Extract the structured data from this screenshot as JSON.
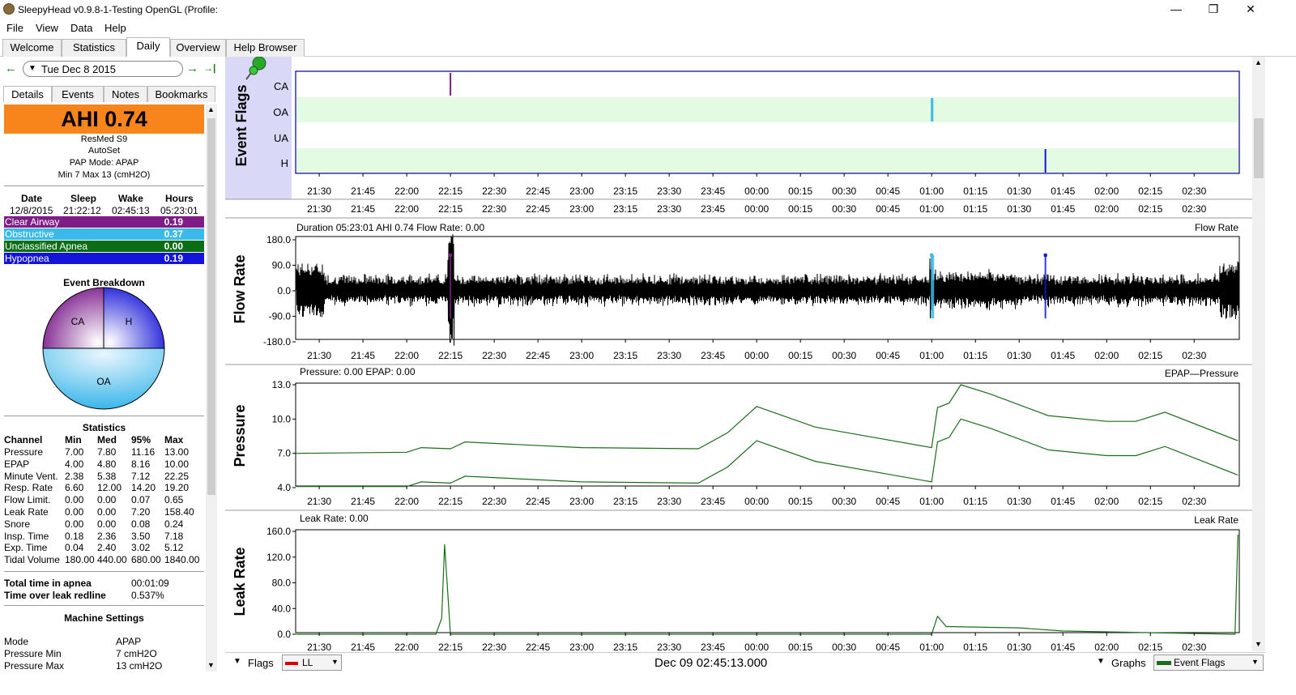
{
  "window": {
    "title": "SleepyHead v0.9.8-1-Testing OpenGL (Profile:",
    "minimize": "—",
    "maximize": "❐",
    "close": "✕"
  },
  "menu": [
    "File",
    "View",
    "Data",
    "Help"
  ],
  "tabs": [
    "Welcome",
    "Statistics",
    "Daily",
    "Overview",
    "Help Browser"
  ],
  "nav": {
    "prev": "←",
    "date": "Tue Dec 8 2015",
    "next": "→",
    "last": "→|"
  },
  "subtabs": [
    "Details",
    "Events",
    "Notes",
    "Bookmarks"
  ],
  "ahi": "AHI 0.74",
  "machine": {
    "model": "ResMed S9",
    "type": "AutoSet",
    "mode": "PAP Mode: APAP",
    "range": "Min 7 Max 13 (cmH2O)"
  },
  "session": {
    "headers": [
      "Date",
      "Sleep",
      "Wake",
      "Hours"
    ],
    "values": [
      "12/8/2015",
      "21:22:12",
      "02:45:13",
      "05:23:01"
    ]
  },
  "events": [
    {
      "name": "Clear Airway",
      "value": "0.19",
      "color": "#7f1d86"
    },
    {
      "name": "Obstructive",
      "value": "0.37",
      "color": "#3bb9e8"
    },
    {
      "name": "Unclassified Apnea",
      "value": "0.00",
      "color": "#0b6e16"
    },
    {
      "name": "Hypopnea",
      "value": "0.19",
      "color": "#1414d9"
    }
  ],
  "breakdown": {
    "title": "Event Breakdown",
    "ca": "CA",
    "h": "H",
    "oa": "OA"
  },
  "statistics": {
    "title": "Statistics",
    "headers": [
      "Channel",
      "Min",
      "Med",
      "95%",
      "Max"
    ],
    "rows": [
      [
        "Pressure",
        "7.00",
        "7.80",
        "11.16",
        "13.00"
      ],
      [
        "EPAP",
        "4.00",
        "4.80",
        "8.16",
        "10.00"
      ],
      [
        "Minute Vent.",
        "2.38",
        "5.38",
        "7.12",
        "22.25"
      ],
      [
        "Resp. Rate",
        "6.60",
        "12.00",
        "14.20",
        "19.20"
      ],
      [
        "Flow Limit.",
        "0.00",
        "0.00",
        "0.07",
        "0.65"
      ],
      [
        "Leak Rate",
        "0.00",
        "0.00",
        "7.20",
        "158.40"
      ],
      [
        "Snore",
        "0.00",
        "0.00",
        "0.08",
        "0.24"
      ],
      [
        "Insp. Time",
        "0.18",
        "2.36",
        "3.50",
        "7.18"
      ],
      [
        "Exp. Time",
        "0.04",
        "2.40",
        "3.02",
        "5.12"
      ],
      [
        "Tidal Volume",
        "180.00",
        "440.00",
        "680.00",
        "1840.00"
      ]
    ]
  },
  "totals": [
    {
      "label": "Total time in apnea",
      "value": "00:01:09"
    },
    {
      "label": "Time over leak redline",
      "value": "0.537%"
    }
  ],
  "machine_settings": {
    "title": "Machine Settings",
    "rows": [
      {
        "label": "Mode",
        "value": "APAP"
      },
      {
        "label": "Pressure Min",
        "value": "7 cmH2O"
      },
      {
        "label": "Pressure Max",
        "value": "13 cmH2O"
      }
    ]
  },
  "time_ticks": [
    "21:30",
    "21:45",
    "22:00",
    "22:15",
    "22:30",
    "22:45",
    "23:00",
    "23:15",
    "23:30",
    "23:45",
    "00:00",
    "00:15",
    "00:30",
    "00:45",
    "01:00",
    "01:15",
    "01:30",
    "01:45",
    "02:00",
    "02:15",
    "02:30"
  ],
  "graphs": {
    "flags": {
      "ylabel": "Event Flags",
      "rows": [
        "CA",
        "OA",
        "UA",
        "H"
      ]
    },
    "flow": {
      "ylabel": "Flow Rate",
      "info": "Duration 05:23:01 AHI 0.74 Flow Rate: 0.00",
      "legend": "Flow Rate",
      "ticks": [
        "180.0",
        "90.0",
        "0.0",
        "-90.0",
        "-180.0"
      ]
    },
    "pressure": {
      "ylabel": "Pressure",
      "info": "Pressure: 0.00 EPAP: 0.00",
      "legend": "EPAP—Pressure",
      "ticks": [
        "13.0",
        "10.0",
        "7.0",
        "4.0"
      ]
    },
    "leak": {
      "ylabel": "Leak Rate",
      "info": "Leak Rate: 0.00",
      "legend": "Leak Rate",
      "ticks": [
        "160.0",
        "120.0",
        "80.0",
        "40.0",
        "0.0"
      ]
    }
  },
  "bottom": {
    "flags_label": "Flags",
    "ll_label": "LL",
    "timestamp": "Dec 09 02:45:13.000",
    "graphs_label": "Graphs",
    "eventflags_label": "Event Flags"
  },
  "chart_data": [
    {
      "type": "scatter",
      "title": "Event Flags",
      "categories": [
        "CA",
        "OA",
        "UA",
        "H"
      ],
      "x_range": [
        "21:22",
        "02:45"
      ],
      "series": [
        {
          "name": "CA",
          "x": [
            "22:15"
          ]
        },
        {
          "name": "OA",
          "x": [
            "01:00"
          ]
        },
        {
          "name": "H",
          "x": [
            "01:39"
          ]
        }
      ]
    },
    {
      "type": "line",
      "title": "Flow Rate",
      "ylim": [
        -180,
        180
      ],
      "series": [
        {
          "name": "Flow Rate",
          "values": [
            0,
            0
          ]
        }
      ]
    },
    {
      "type": "line",
      "title": "Pressure",
      "ylim": [
        4,
        13
      ],
      "x": [
        "21:22",
        "22:00",
        "22:05",
        "22:15",
        "22:20",
        "23:00",
        "23:40",
        "23:50",
        "00:00",
        "00:20",
        "01:00",
        "01:02",
        "01:06",
        "01:10",
        "01:20",
        "01:40",
        "02:00",
        "02:10",
        "02:20",
        "02:45"
      ],
      "series": [
        {
          "name": "Pressure",
          "values": [
            7.0,
            7.1,
            7.5,
            7.4,
            8.0,
            7.5,
            7.4,
            8.8,
            11.1,
            9.3,
            7.5,
            11.0,
            11.4,
            13.0,
            12.2,
            10.3,
            9.8,
            9.8,
            10.6,
            8.1
          ]
        },
        {
          "name": "EPAP",
          "values": [
            4.1,
            4.1,
            4.5,
            4.4,
            5.0,
            4.5,
            4.4,
            5.8,
            8.1,
            6.3,
            4.5,
            8.0,
            8.4,
            10.0,
            9.2,
            7.3,
            6.8,
            6.8,
            7.6,
            5.1
          ]
        }
      ]
    },
    {
      "type": "line",
      "title": "Leak Rate",
      "ylim": [
        0,
        160
      ],
      "x": [
        "21:22",
        "22:10",
        "22:12",
        "22:13",
        "22:15",
        "22:30",
        "00:00",
        "01:00",
        "01:02",
        "01:05",
        "01:30",
        "01:45",
        "02:44",
        "02:45"
      ],
      "series": [
        {
          "name": "Leak Rate",
          "values": [
            0,
            0,
            25,
            140,
            0,
            0,
            0,
            0,
            28,
            12,
            10,
            5,
            0,
            155
          ]
        }
      ]
    }
  ]
}
